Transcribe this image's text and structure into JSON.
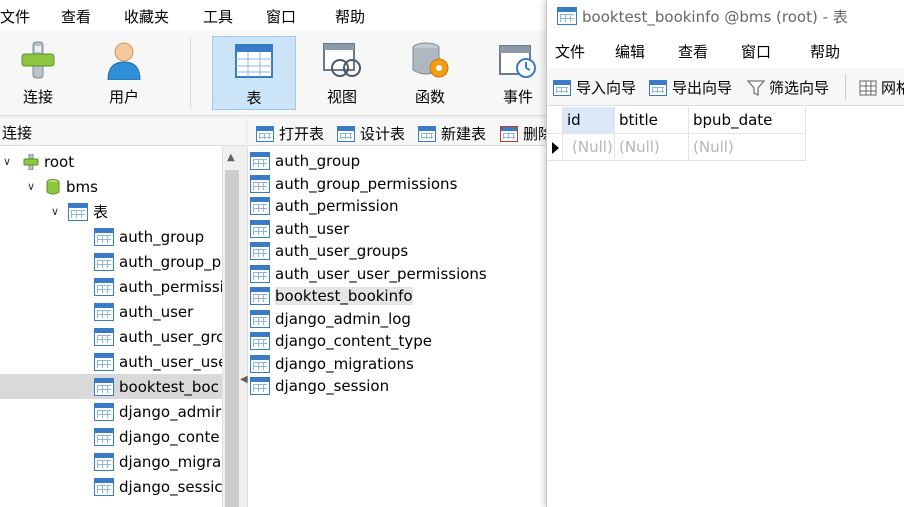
{
  "menubar": {
    "items": [
      "文件",
      "查看",
      "收藏夹",
      "工具",
      "窗口",
      "帮助"
    ]
  },
  "toolbar": {
    "buttons": [
      {
        "label": "连接",
        "icon": "connection-icon"
      },
      {
        "label": "用户",
        "icon": "user-icon"
      },
      {
        "label": "表",
        "icon": "table-icon",
        "active": true
      },
      {
        "label": "视图",
        "icon": "view-icon"
      },
      {
        "label": "函数",
        "icon": "function-icon"
      },
      {
        "label": "事件",
        "icon": "event-icon"
      }
    ]
  },
  "connection_panel": {
    "header": "连接",
    "tree": [
      {
        "label": "root",
        "level": 0,
        "icon": "connection-icon"
      },
      {
        "label": "bms",
        "level": 1,
        "icon": "database-icon"
      },
      {
        "label": "表",
        "level": 2,
        "icon": "table-icon"
      },
      {
        "label": "auth_group",
        "level": 3
      },
      {
        "label": "auth_group_p",
        "level": 3
      },
      {
        "label": "auth_permissi",
        "level": 3
      },
      {
        "label": "auth_user",
        "level": 3
      },
      {
        "label": "auth_user_grc",
        "level": 3
      },
      {
        "label": "auth_user_use",
        "level": 3
      },
      {
        "label": "booktest_boc",
        "level": 3,
        "selected": true
      },
      {
        "label": "django_admir",
        "level": 3
      },
      {
        "label": "django_conte",
        "level": 3
      },
      {
        "label": "django_migra",
        "level": 3
      },
      {
        "label": "django_sessic",
        "level": 3
      }
    ]
  },
  "object_toolbar": {
    "open": "打开表",
    "design": "设计表",
    "new": "新建表",
    "delete": "删除"
  },
  "object_list": [
    "auth_group",
    "auth_group_permissions",
    "auth_permission",
    "auth_user",
    "auth_user_groups",
    "auth_user_user_permissions",
    "booktest_bookinfo",
    "django_admin_log",
    "django_content_type",
    "django_migrations",
    "django_session"
  ],
  "object_selected": "booktest_bookinfo",
  "table_window": {
    "title": "booktest_bookinfo @bms (root) - 表",
    "menu": [
      "文件",
      "编辑",
      "查看",
      "窗口",
      "帮助"
    ],
    "toolbar": {
      "import": "导入向导",
      "export": "导出向导",
      "filter": "筛选向导",
      "grid": "网格"
    },
    "columns": [
      "id",
      "btitle",
      "bpub_date"
    ],
    "rows": [
      [
        "(Null)",
        "(Null)",
        "(Null)"
      ]
    ]
  },
  "colors": {
    "accent": "#cce4f7",
    "table_icon": "#3a7bc8",
    "null_text": "#b5b5b5"
  }
}
